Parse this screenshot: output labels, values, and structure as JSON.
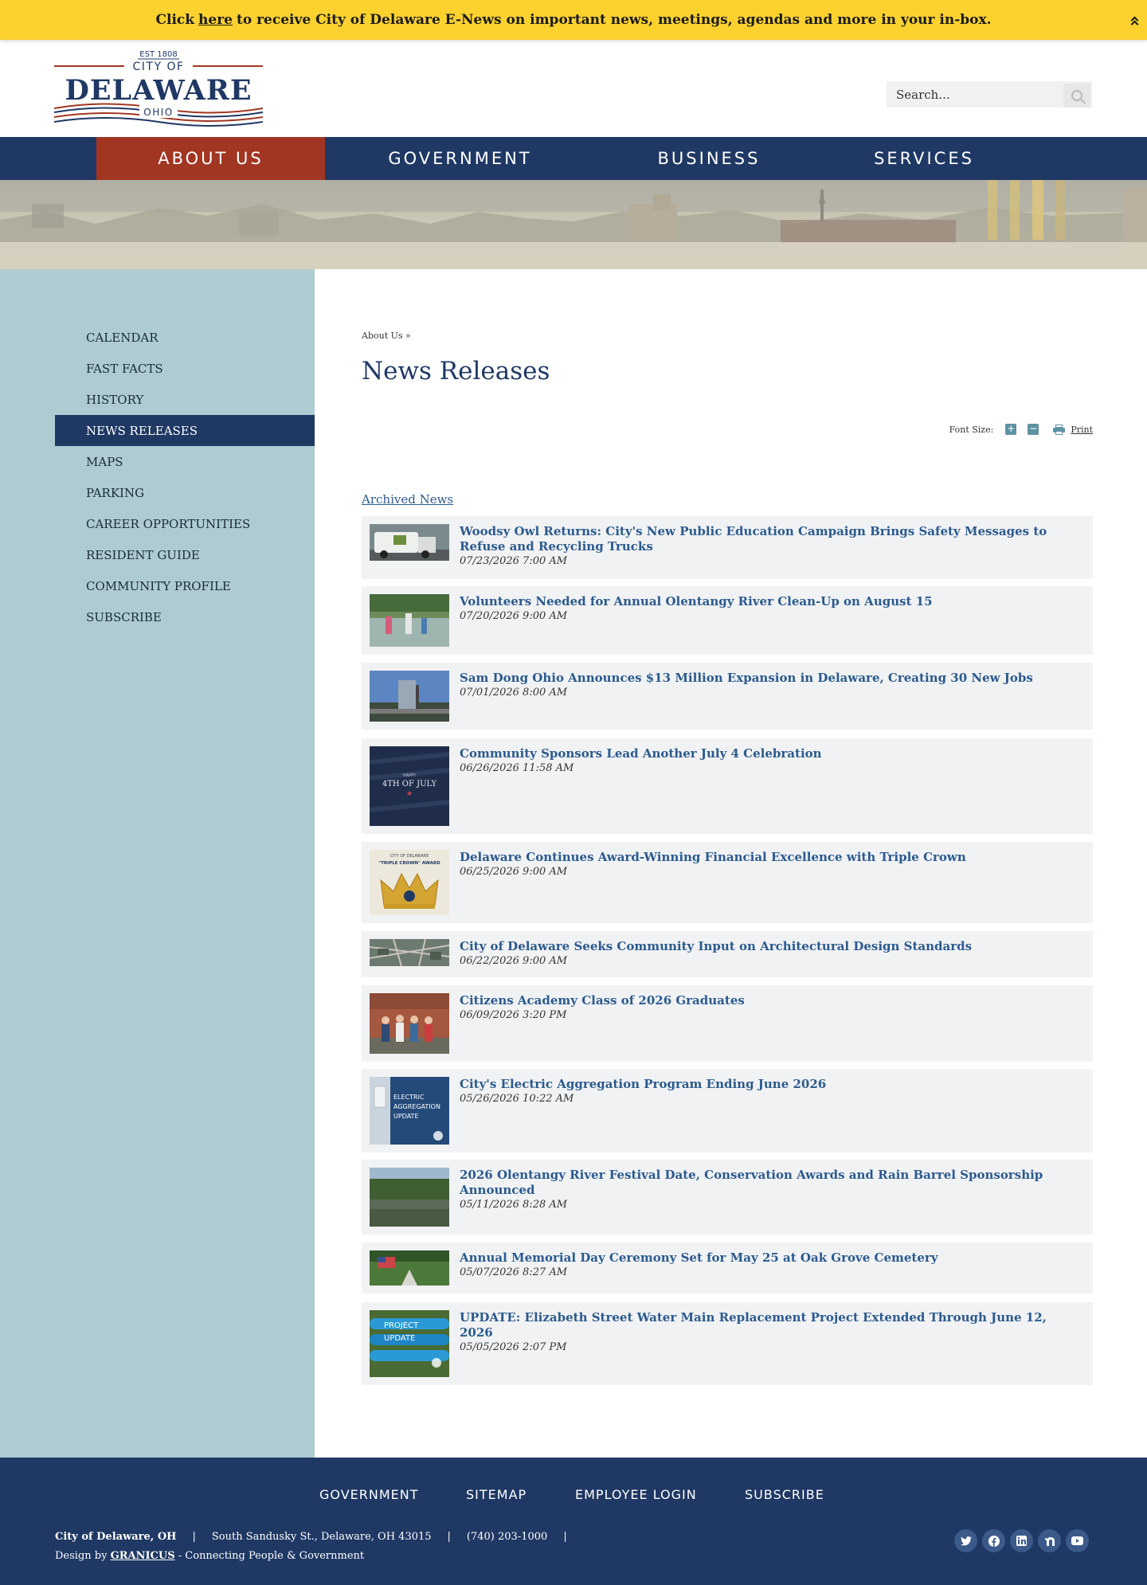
{
  "alert": {
    "prefix": "Click",
    "link": "here",
    "suffix": "to receive City of Delaware E-News on important news, meetings, agendas and more in your in-box."
  },
  "logo": {
    "est": "EST 1808",
    "city_of": "CITY OF",
    "name": "DELAWARE",
    "state": "OHIO"
  },
  "search": {
    "placeholder": "Search..."
  },
  "nav": {
    "items": [
      {
        "label": "ABOUT US"
      },
      {
        "label": "GOVERNMENT"
      },
      {
        "label": "BUSINESS"
      },
      {
        "label": "SERVICES"
      }
    ]
  },
  "sidebar": {
    "items": [
      {
        "label": "CALENDAR"
      },
      {
        "label": "FAST FACTS"
      },
      {
        "label": "HISTORY"
      },
      {
        "label": "NEWS RELEASES"
      },
      {
        "label": "MAPS"
      },
      {
        "label": "PARKING"
      },
      {
        "label": "CAREER OPPORTUNITIES"
      },
      {
        "label": "RESIDENT GUIDE"
      },
      {
        "label": "COMMUNITY PROFILE"
      },
      {
        "label": "SUBSCRIBE"
      }
    ]
  },
  "content": {
    "breadcrumb": "About Us »",
    "title": "News Releases",
    "font_size_label": "Font Size:",
    "font_plus": "+",
    "font_minus": "−",
    "print_label": "Print",
    "archived_label": "Archived News"
  },
  "news": [
    {
      "title": "Woodsy Owl Returns: City's New Public Education Campaign Brings Safety Messages to Refuse and Recycling Trucks",
      "date": "07/23/2026 7:00 AM"
    },
    {
      "title": "Volunteers Needed for Annual Olentangy River Clean-Up on August 15",
      "date": "07/20/2026 9:00 AM"
    },
    {
      "title": "Sam Dong Ohio Announces $13 Million Expansion in Delaware, Creating 30 New Jobs",
      "date": "07/01/2026 8:00 AM"
    },
    {
      "title": "Community Sponsors Lead Another July 4 Celebration",
      "date": "06/26/2026 11:58 AM",
      "thumb_small": "HAPPY",
      "thumb_big": "4TH OF JULY"
    },
    {
      "title": "Delaware Continues Award-Winning Financial Excellence with Triple Crown",
      "date": "06/25/2026 9:00 AM",
      "thumb_small": "CITY OF DELAWARE",
      "thumb_big": "\"TRIPLE CROWN\" AWARD"
    },
    {
      "title": "City of Delaware Seeks Community Input on Architectural Design Standards",
      "date": "06/22/2026 9:00 AM"
    },
    {
      "title": "Citizens Academy Class of 2026 Graduates",
      "date": "06/09/2026 3:20 PM"
    },
    {
      "title": "City's Electric Aggregation Program Ending June 2026",
      "date": "05/26/2026 10:22 AM",
      "thumb_l1": "ELECTRIC",
      "thumb_l2": "AGGREGATION",
      "thumb_l3": "UPDATE"
    },
    {
      "title": "2026 Olentangy River Festival Date, Conservation Awards and Rain Barrel Sponsorship Announced",
      "date": "05/11/2026 8:28 AM"
    },
    {
      "title": "Annual Memorial Day Ceremony Set for May 25 at Oak Grove Cemetery",
      "date": "05/07/2026 8:27 AM"
    },
    {
      "title": "UPDATE: Elizabeth Street Water Main Replacement Project Extended Through June 12, 2026",
      "date": "05/05/2026 2:07 PM",
      "thumb_l1": "PROJECT",
      "thumb_l2": "UPDATE"
    }
  ],
  "footer": {
    "links": [
      {
        "label": "GOVERNMENT"
      },
      {
        "label": "SITEMAP"
      },
      {
        "label": "EMPLOYEE LOGIN"
      },
      {
        "label": "SUBSCRIBE"
      }
    ],
    "city": "City of Delaware, OH",
    "address": "South Sandusky St., Delaware, OH 43015",
    "phone": "(740) 203-1000",
    "separator": "|",
    "design_prefix": "Design by",
    "design_company": "GRANICUS",
    "design_suffix": "- Connecting People & Government",
    "social": [
      "twitter-icon",
      "facebook-icon",
      "linkedin-icon",
      "nextdoor-icon",
      "youtube-icon"
    ]
  },
  "colors": {
    "alert": "#fdd22f",
    "navy": "#1f3864",
    "active_nav": "#a13622",
    "sidebar": "#aecbd1",
    "link": "#2b5a8f"
  }
}
